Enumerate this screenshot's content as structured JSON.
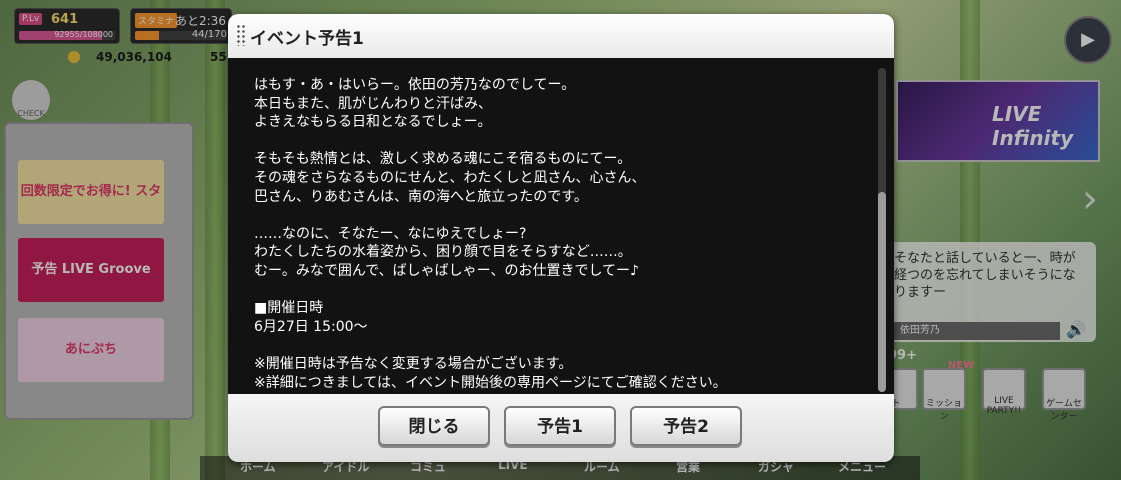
{
  "hud": {
    "plv_tag": "P.Lv",
    "plv_value": "641",
    "plv_exp": "92955/108000",
    "plv_progress": 0.86,
    "stamina_tag": "スタミナ",
    "stamina_timer": "あと2:36",
    "stamina_value": "44/170",
    "stamina_progress": 0.26,
    "money": "49,036,104",
    "gems": "55"
  },
  "check_label": "CHECK",
  "side_cards": [
    "回数限定でお得に! スタージュエル販売",
    "予告 LIVE Groove Vocal burst",
    "あにぷち"
  ],
  "banner_text": "LIVE Infinity",
  "talk": {
    "text": "そなたと話していると一、時が経つのを忘れてしまいそうになりますー",
    "speaker": "依田芳乃"
  },
  "menu_tiles": [
    "ト",
    "ミッション",
    "LIVE PARTY!!",
    "ゲームセンター"
  ],
  "badges": {
    "count": "99+",
    "new": "NEW"
  },
  "nav": [
    "ホーム",
    "アイドル",
    "コミュ",
    "LIVE",
    "ルーム",
    "営業",
    "ガシャ",
    "メニュー"
  ],
  "dialog": {
    "title": "イベント予告1",
    "body": "はもす・あ・はいらー。依田の芳乃なのでしてー。\n本日もまた、肌がじんわりと汗ばみ、\nよきえなもらる日和となるでしょー。\n\nそもそも熱情とは、激しく求める魂にこそ宿るものにてー。\nその魂をさらなるものにせんと、わたくしと凪さん、心さん、\n巴さん、りあむさんは、南の海へと旅立ったのです。\n\n……なのに、そなたー、なにゆえでしょー?\nわたくしたちの水着姿から、困り顔で目をそらすなど……。\nむー。みなで囲んで、ばしゃばしゃー、のお仕置きでしてー♪\n\n■開催日時\n6月27日 15:00～\n\n※開催日時は予告なく変更する場合がございます。\n※詳細につきましては、イベント開始後の専用ページにてご確認ください。",
    "buttons": {
      "close": "閉じる",
      "preview1": "予告1",
      "preview2": "予告2"
    }
  },
  "colors": {
    "plv_bar": "#e05b9a",
    "stamina_bar": "#ff9a2e",
    "dialog_bg": "#121212",
    "dialog_text": "#ffffff"
  }
}
